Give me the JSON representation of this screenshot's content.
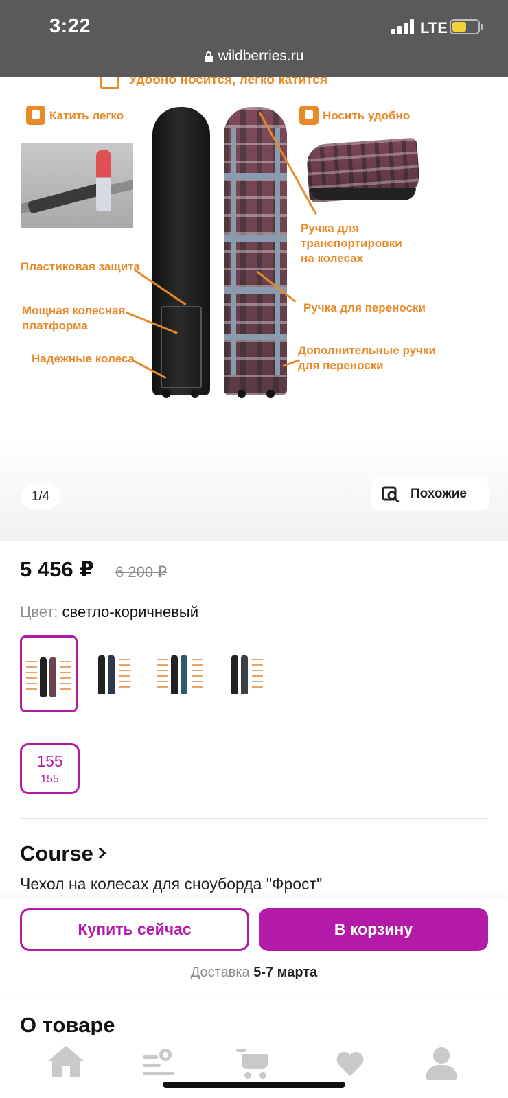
{
  "status_bar": {
    "time": "3:22",
    "network": "LTE",
    "url": "wildberries.ru"
  },
  "gallery": {
    "promo_labels": {
      "title": "Удобно носится, легко катится",
      "roll_easy": "Катить легко",
      "carry_easy": "Носить удобно",
      "plastic_protection": "Пластиковая защита",
      "wheel_platform_1": "Мощная колесная",
      "wheel_platform_2": "платформа",
      "reliable_wheels": "Надежные колеса",
      "transport_handle_1": "Ручка для",
      "transport_handle_2": "транспортировки",
      "transport_handle_3": "на колесах",
      "carry_handle": "Ручка для переноски",
      "extra_handles_1": "Дополнительные ручки",
      "extra_handles_2": "для переноски"
    },
    "pager": "1/4",
    "similar_label": "Похожие"
  },
  "product": {
    "price": "5 456 ₽",
    "old_price": "6 200 ₽",
    "color_label": "Цвет:",
    "color_value": "светло-коричневый",
    "size": "155",
    "size_sub": "155",
    "brand": "Course",
    "name": "Чехол на колесах для сноуборда \"Фрост\""
  },
  "buy_bar": {
    "buy_now": "Купить сейчас",
    "to_cart": "В корзину",
    "delivery_label": "Доставка",
    "delivery_date": "5-7 марта"
  },
  "sections": {
    "about": "О товаре"
  },
  "tabs": [
    {
      "icon": "home-icon"
    },
    {
      "icon": "catalog-search-icon"
    },
    {
      "icon": "cart-icon"
    },
    {
      "icon": "heart-icon"
    },
    {
      "icon": "profile-icon"
    }
  ],
  "colors": {
    "accent": "#b21aa7",
    "promo_orange": "#e8892a",
    "status_bar_bg": "#5a5a5a",
    "muted_text": "#8c8c8c",
    "tab_icon": "#c9c9c9"
  }
}
